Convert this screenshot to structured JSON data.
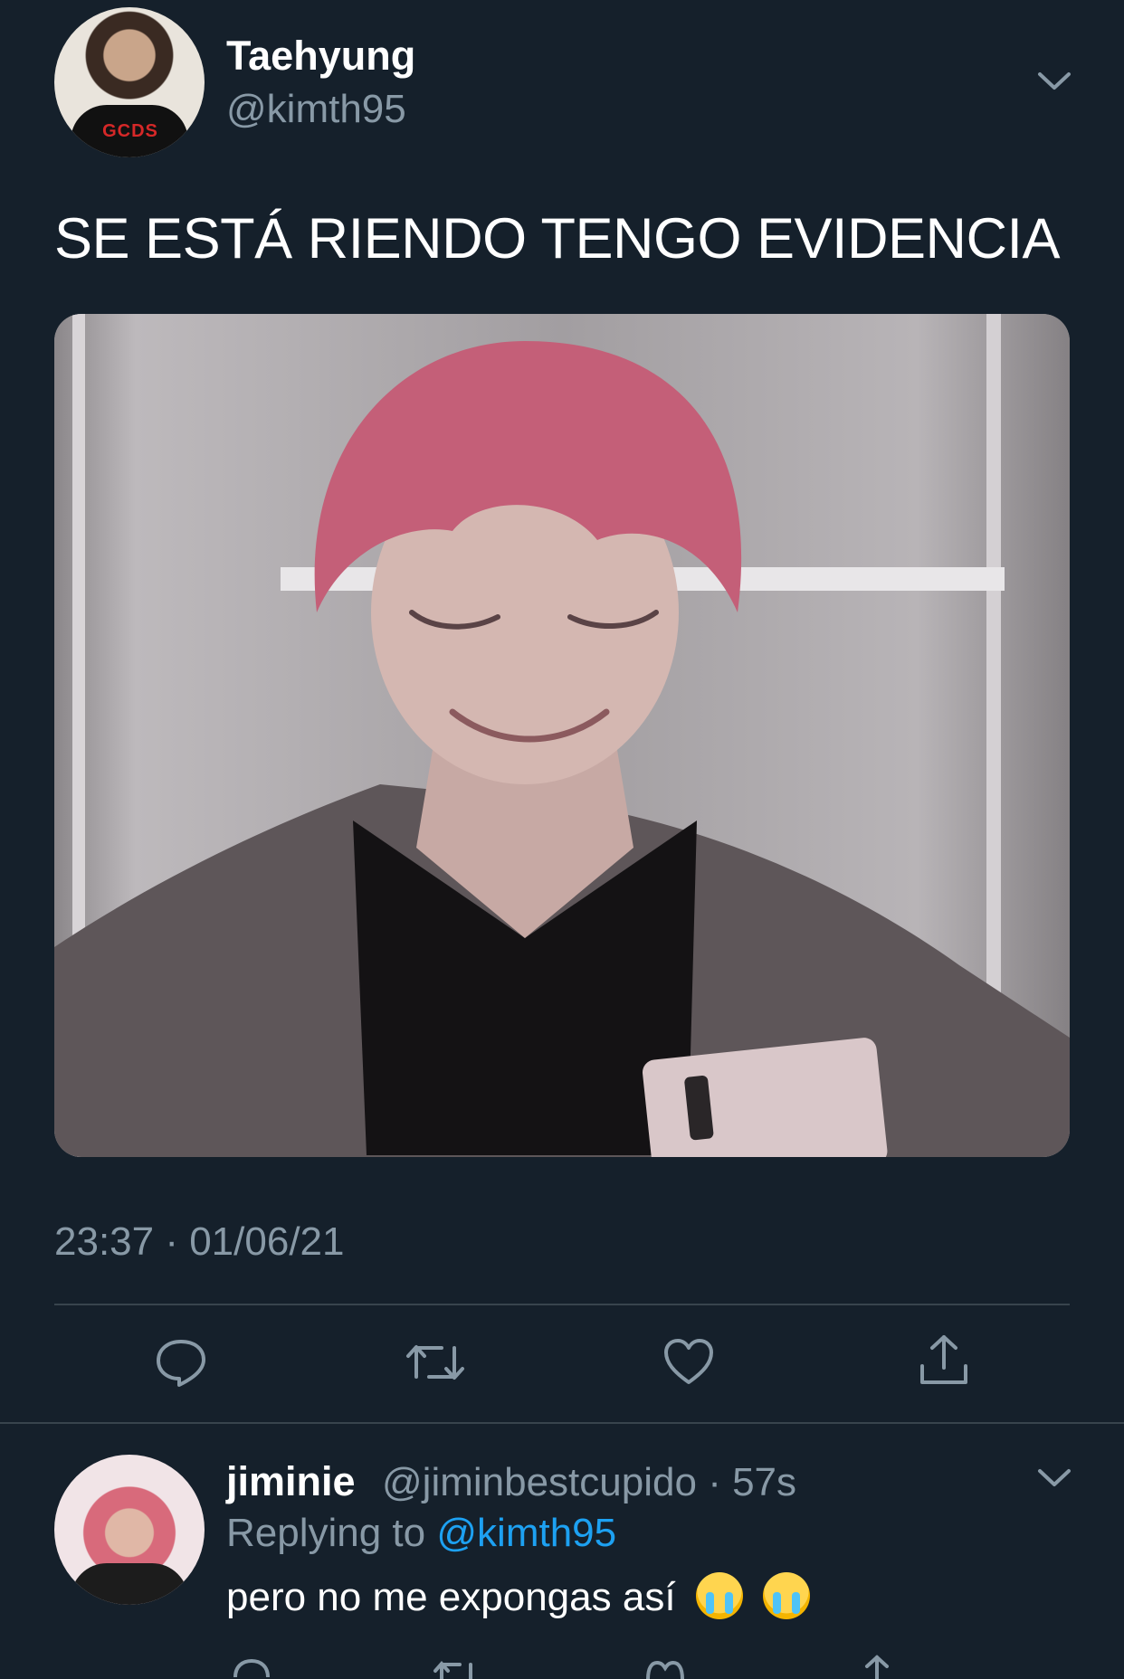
{
  "tweet": {
    "author_name": "Taehyung",
    "author_handle": "@kimth95",
    "avatar_logo_text": "GCDS",
    "text": "SE ESTÁ RIENDO TENGO EVIDENCIA",
    "timestamp": "23:37 · 01/06/21",
    "actions": [
      "comment-icon",
      "retweet-icon",
      "like-icon",
      "share-icon"
    ]
  },
  "reply": {
    "author_name": "jiminie",
    "author_handle": "@jiminbestcupido",
    "time": "· 57s",
    "replying_prefix": "Replying to",
    "replying_mention": "@kimth95",
    "text": "pero no me expongas así",
    "emojis": [
      "loudly-crying-face",
      "loudly-crying-face"
    ]
  },
  "colors": {
    "background": "#15202b",
    "secondary_text": "#8899a6",
    "accent": "#1da1f2",
    "divider": "#38444d"
  }
}
